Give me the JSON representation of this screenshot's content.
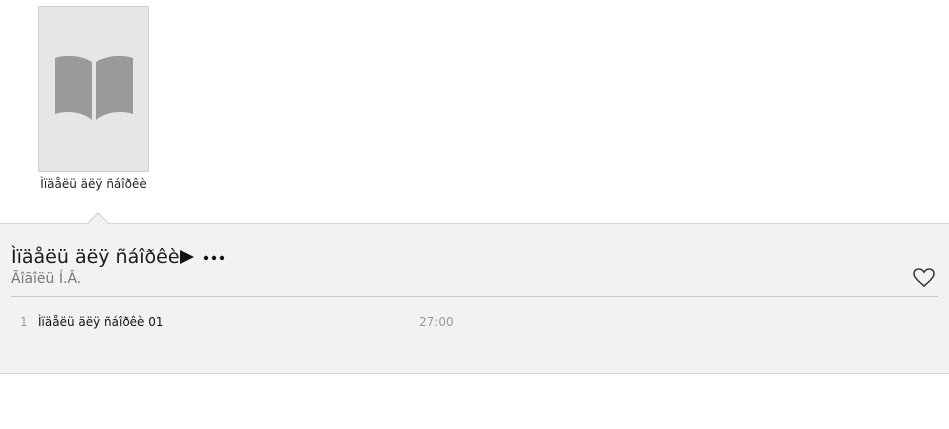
{
  "book": {
    "cover_icon": "open-book-icon",
    "title": "Ìïäåëü äëÿ ñáîðêè"
  },
  "album": {
    "title": "Ìïäåëü äëÿ ñáîðêè",
    "artist": "Ãîãîëü Í.Â.",
    "play_icon": "play-icon",
    "more_icon": "more-icon",
    "heart_icon": "heart-icon"
  },
  "tracks": [
    {
      "number": "1",
      "name": "Ìïäåëü äëÿ ñáîðêè 01",
      "duration": "27:00"
    }
  ],
  "colors": {
    "panel_bg": "#f2f2f2",
    "cover_bg": "#e6e6e6",
    "icon_gray": "#9a9a9a"
  }
}
